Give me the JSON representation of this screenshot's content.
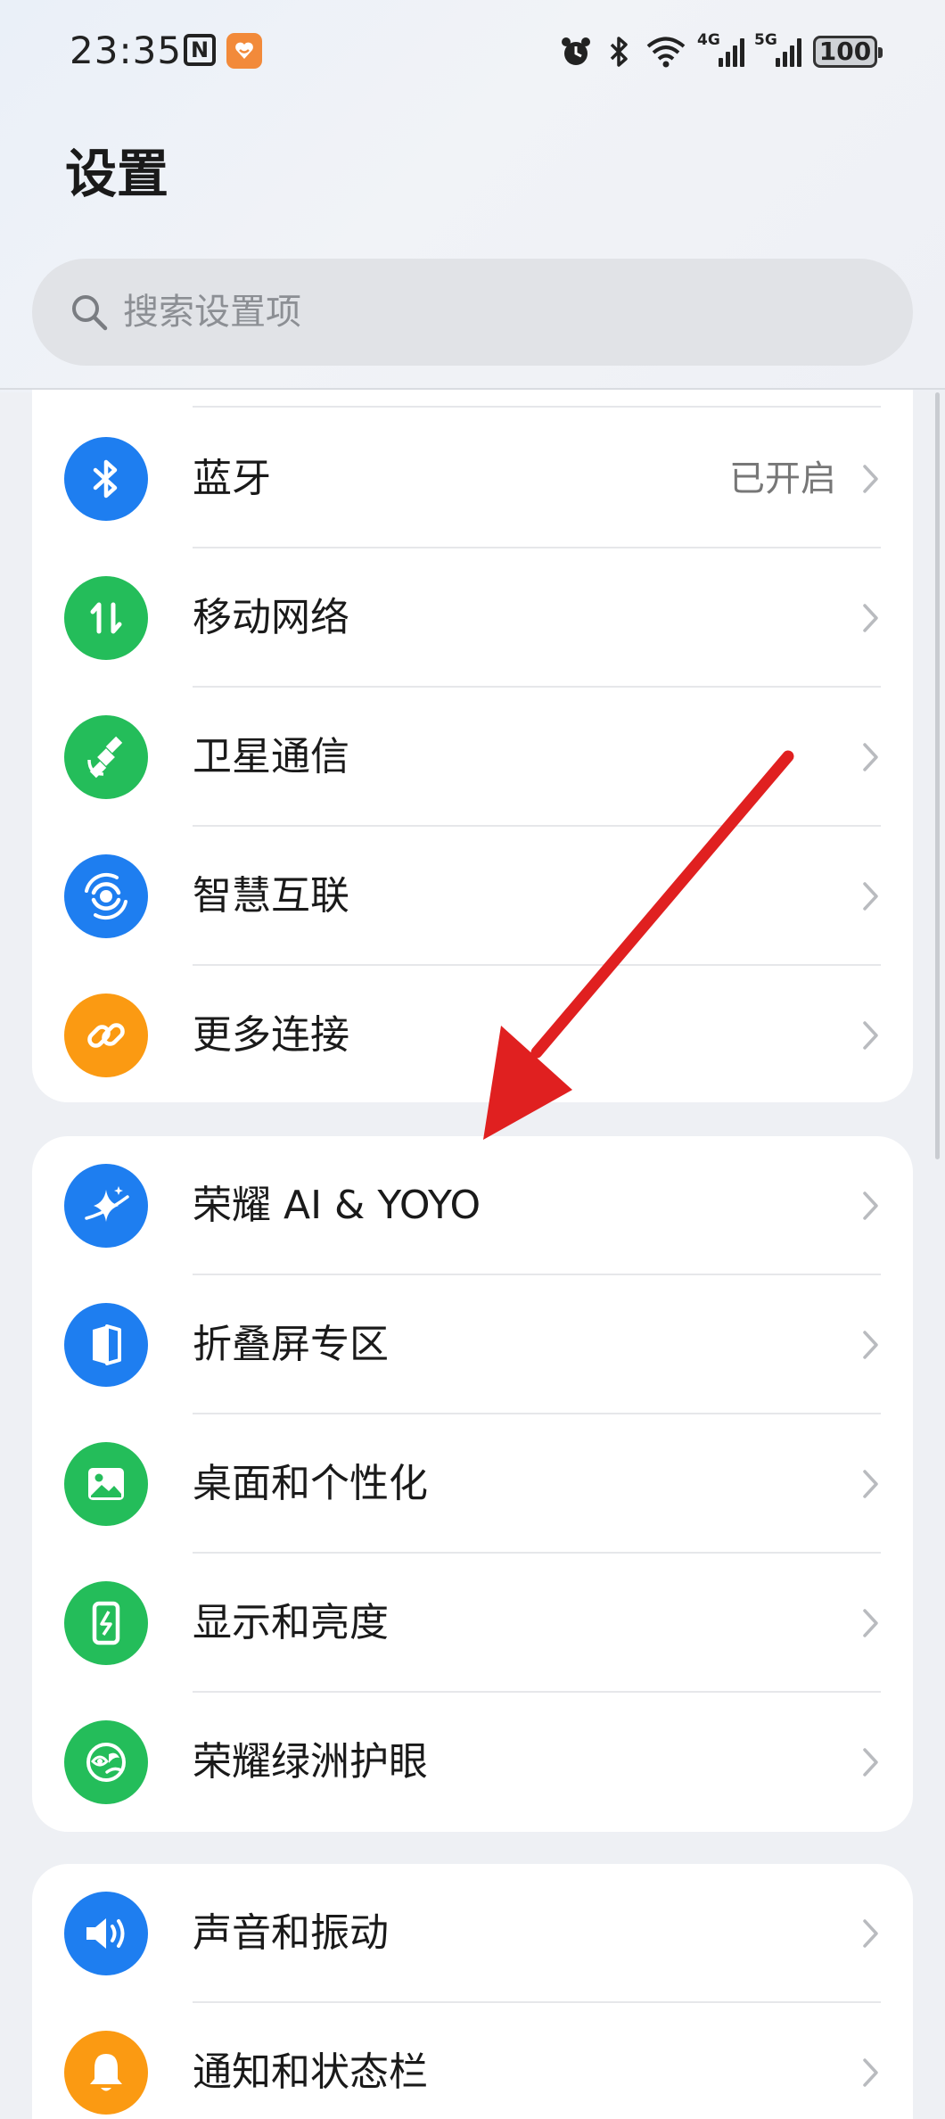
{
  "status_bar": {
    "time": "23:35",
    "nfc_label": "N",
    "network_4g": "4G",
    "network_5g": "5G",
    "battery": "100"
  },
  "page": {
    "title": "设置"
  },
  "search": {
    "placeholder": "搜索设置项"
  },
  "groups": [
    {
      "items": [
        {
          "label": "蓝牙",
          "value": "已开启",
          "icon": "bluetooth-icon",
          "color": "#1e7ef0"
        },
        {
          "label": "移动网络",
          "icon": "mobile-data-icon",
          "color": "#24bd5a"
        },
        {
          "label": "卫星通信",
          "icon": "satellite-icon",
          "color": "#24bd5a"
        },
        {
          "label": "智慧互联",
          "icon": "smart-connect-icon",
          "color": "#1e7ef0"
        },
        {
          "label": "更多连接",
          "icon": "link-icon",
          "color": "#fb9a12"
        }
      ]
    },
    {
      "items": [
        {
          "label": "荣耀 AI & YOYO",
          "icon": "sparkle-icon",
          "color": "#1e7ef0"
        },
        {
          "label": "折叠屏专区",
          "icon": "foldable-icon",
          "color": "#1e7ef0"
        },
        {
          "label": "桌面和个性化",
          "icon": "image-icon",
          "color": "#24bd5a"
        },
        {
          "label": "显示和亮度",
          "icon": "display-icon",
          "color": "#24bd5a"
        },
        {
          "label": "荣耀绿洲护眼",
          "icon": "eye-care-icon",
          "color": "#24bd5a"
        }
      ]
    },
    {
      "items": [
        {
          "label": "声音和振动",
          "icon": "speaker-icon",
          "color": "#1e7ef0"
        },
        {
          "label": "通知和状态栏",
          "icon": "bell-icon",
          "color": "#fb9a12"
        }
      ]
    }
  ],
  "annotation": {
    "arrow_color": "#e02020"
  }
}
